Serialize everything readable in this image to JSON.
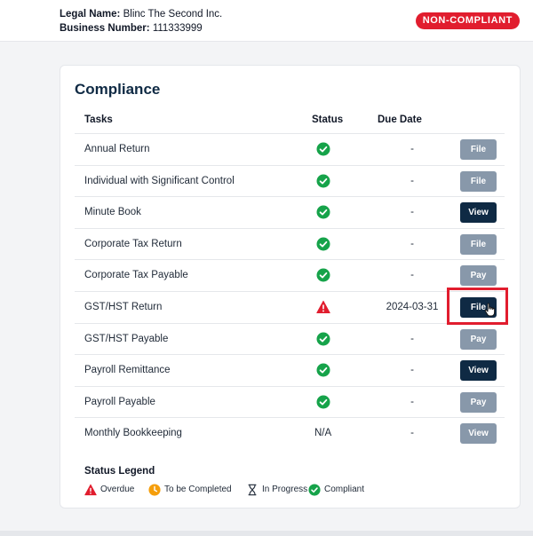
{
  "header": {
    "legal_name_label": "Legal Name:",
    "legal_name_value": "Blinc The Second Inc.",
    "business_number_label": "Business Number:",
    "business_number_value": "111333999",
    "status_badge": "NON-COMPLIANT"
  },
  "compliance": {
    "title": "Compliance",
    "columns": {
      "tasks": "Tasks",
      "status": "Status",
      "due_date": "Due Date"
    },
    "rows": [
      {
        "task": "Annual Return",
        "status": "check-icon",
        "due": "-",
        "action": "File",
        "action_style": "muted"
      },
      {
        "task": "Individual with Significant Control",
        "status": "check-icon",
        "due": "-",
        "action": "File",
        "action_style": "muted"
      },
      {
        "task": "Minute Book",
        "status": "check-icon",
        "due": "-",
        "action": "View",
        "action_style": "dark"
      },
      {
        "task": "Corporate Tax Return",
        "status": "check-icon",
        "due": "-",
        "action": "File",
        "action_style": "muted"
      },
      {
        "task": "Corporate Tax Payable",
        "status": "check-icon",
        "due": "-",
        "action": "Pay",
        "action_style": "muted"
      },
      {
        "task": "GST/HST Return",
        "status": "warning-icon",
        "due": "2024-03-31",
        "action": "File",
        "action_style": "dark"
      },
      {
        "task": "GST/HST Payable",
        "status": "check-icon",
        "due": "-",
        "action": "Pay",
        "action_style": "muted"
      },
      {
        "task": "Payroll Remittance",
        "status": "check-icon",
        "due": "-",
        "action": "View",
        "action_style": "dark"
      },
      {
        "task": "Payroll Payable",
        "status": "check-icon",
        "due": "-",
        "action": "Pay",
        "action_style": "muted"
      },
      {
        "task": "Monthly Bookkeeping",
        "status_text": "N/A",
        "due": "-",
        "action": "View",
        "action_style": "muted"
      }
    ]
  },
  "legend": {
    "title": "Status Legend",
    "items": [
      {
        "icon": "warning-icon",
        "label": "Overdue"
      },
      {
        "icon": "clock-icon",
        "label": "To be Completed"
      },
      {
        "icon": "hourglass-icon",
        "label": "In Progress"
      },
      {
        "icon": "check-icon",
        "label": "Compliant"
      }
    ]
  },
  "colors": {
    "brand_dark": "#0f2a44",
    "button_muted": "#8898aa",
    "alert_red": "#e11d2e",
    "compliant_green": "#16a34a",
    "to_be_completed_orange": "#f59e0b"
  }
}
